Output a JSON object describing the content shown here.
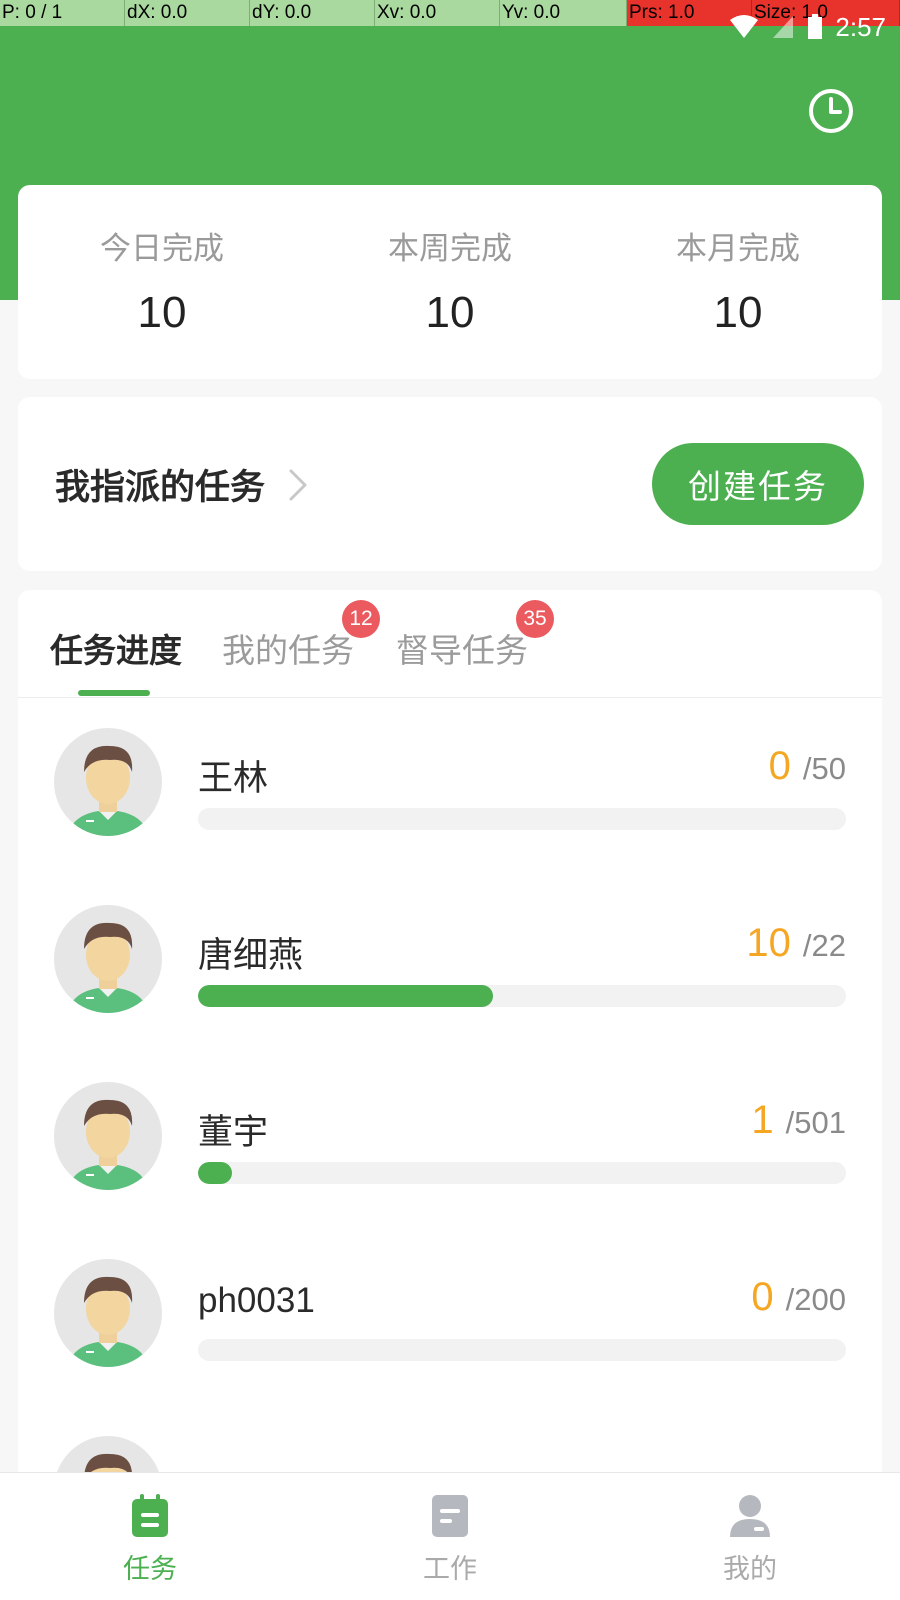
{
  "debug": {
    "p": "P: 0 / 1",
    "dx": "dX: 0.0",
    "dy": "dY: 0.0",
    "xv": "Xv: 0.0",
    "yv": "Yv: 0.0",
    "prs": "Prs: 1.0",
    "size": "Size: 1.0"
  },
  "status_bar": {
    "time": "2:57"
  },
  "stats": [
    {
      "label": "今日完成",
      "value": "10"
    },
    {
      "label": "本周完成",
      "value": "10"
    },
    {
      "label": "本月完成",
      "value": "10"
    }
  ],
  "assigned": {
    "title": "我指派的任务",
    "create_label": "创建任务"
  },
  "tabs": [
    {
      "label": "任务进度",
      "badge": ""
    },
    {
      "label": "我的任务",
      "badge": "12"
    },
    {
      "label": "督导任务",
      "badge": "35"
    }
  ],
  "people": [
    {
      "name": "王林",
      "done": "0",
      "total": "/50",
      "progress": 0
    },
    {
      "name": "唐细燕",
      "done": "10",
      "total": "/22",
      "progress": 0.4545
    },
    {
      "name": "董宇",
      "done": "1",
      "total": "/501",
      "progress": 0.002
    },
    {
      "name": "ph0031",
      "done": "0",
      "total": "/200",
      "progress": 0
    }
  ],
  "nav": [
    {
      "label": "任务"
    },
    {
      "label": "工作"
    },
    {
      "label": "我的"
    }
  ],
  "colors": {
    "accent": "#4caf50",
    "count": "#f5a623",
    "badge": "#ea5a5f"
  }
}
